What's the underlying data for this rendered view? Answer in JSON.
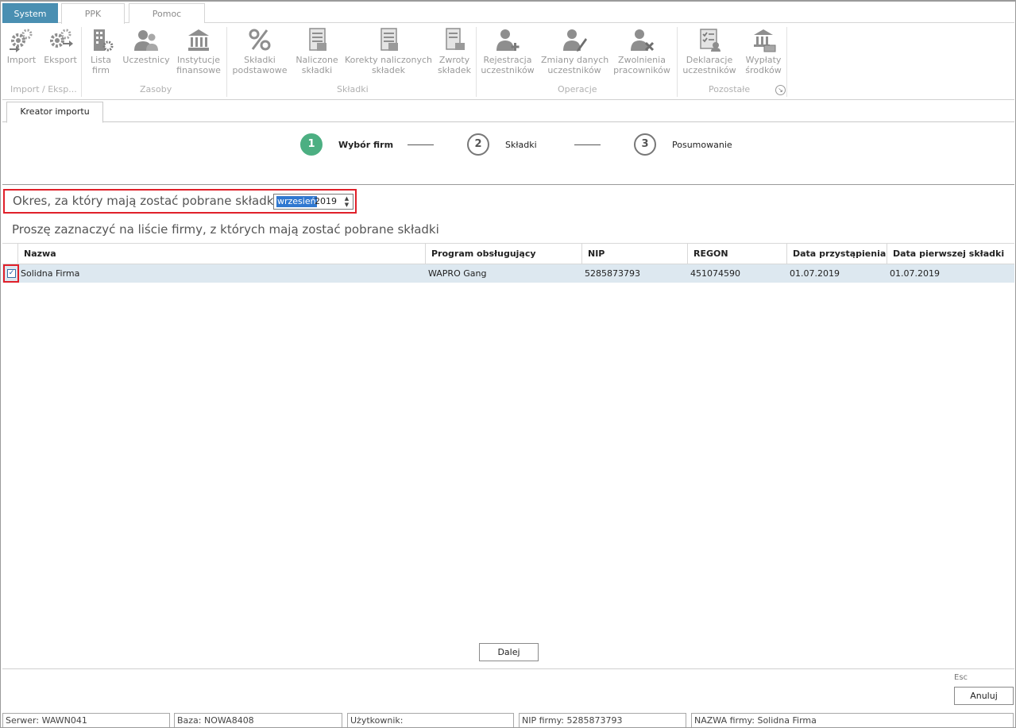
{
  "ribbon_tabs": {
    "system": "System",
    "ppk": "PPK",
    "pomoc": "Pomoc"
  },
  "ribbon": {
    "buttons": {
      "import": [
        "Import",
        ""
      ],
      "eksport": [
        "Eksport",
        ""
      ],
      "lista_firm": [
        "Lista",
        "firm"
      ],
      "uczestnicy": [
        "Uczestnicy",
        ""
      ],
      "instytucje": [
        "Instytucje",
        "finansowe"
      ],
      "skladki_podstawowe": [
        "Składki",
        "podstawowe"
      ],
      "naliczone": [
        "Naliczone",
        "składki"
      ],
      "korekty": [
        "Korekty naliczonych",
        "składek"
      ],
      "zwroty": [
        "Zwroty",
        "składek"
      ],
      "rejestracja": [
        "Rejestracja",
        "uczestników"
      ],
      "zmiany": [
        "Zmiany danych",
        "uczestników"
      ],
      "zwolnienia": [
        "Zwolnienia",
        "pracowników"
      ],
      "deklaracje": [
        "Deklaracje",
        "uczestników"
      ],
      "wyplaty": [
        "Wypłaty",
        "środków"
      ]
    },
    "groups": {
      "import_eksport": "Import / Eksp...",
      "zasoby": "Zasoby",
      "skladki": "Składki",
      "operacje": "Operacje",
      "pozostale": "Pozostałe"
    },
    "icons": {
      "import": "import-gears-icon",
      "eksport": "export-gears-icon",
      "lista_firm": "building-gear-icon",
      "uczestnicy": "users-icon",
      "instytucje": "bank-icon",
      "skladki_podstawowe": "percent-icon",
      "naliczone": "calculator-sheet-icon",
      "korekty": "correction-sheet-icon",
      "zwroty": "return-document-icon",
      "rejestracja": "user-add-icon",
      "zmiany": "user-edit-icon",
      "zwolnienia": "user-remove-icon",
      "deklaracje": "declaration-checklist-icon",
      "wyplaty": "payout-bank-icon"
    }
  },
  "doc_tab": {
    "label": "Kreator importu"
  },
  "wizard": {
    "steps": [
      {
        "number": "1",
        "label": "Wybór firm",
        "active": true
      },
      {
        "number": "2",
        "label": "Składki",
        "active": false
      },
      {
        "number": "3",
        "label": "Posumowanie",
        "active": false
      }
    ],
    "active_color": "#4caf82"
  },
  "period": {
    "label": "Okres, za który mają zostać pobrane składki",
    "month": "wrzesień",
    "year": "2019"
  },
  "instruction": "Proszę zaznaczyć na liście firmy, z których mają zostać pobrane składki",
  "grid": {
    "columns": [
      "Nazwa",
      "Program obsługujący",
      "NIP",
      "REGON",
      "Data przystąpienia",
      "Data pierwszej składki"
    ],
    "rows": [
      {
        "checked": true,
        "nazwa": "Solidna Firma",
        "program": "WAPRO Gang",
        "nip": "5285873793",
        "regon": "451074590",
        "data_przystapienia": "01.07.2019",
        "data_pierwszej_skladki": "01.07.2019"
      }
    ]
  },
  "buttons": {
    "next": "Dalej",
    "cancel": "Anuluj",
    "esc_hint": "Esc"
  },
  "statusbar": {
    "server": "Serwer: WAWN041",
    "db": "Baza: NOWA8408",
    "user": "Użytkownik:",
    "nip": "NIP firmy: 5285873793",
    "company": "NAZWA firmy: Solidna Firma"
  },
  "colors": {
    "system_tab": "#4a8fb2",
    "highlight_border": "#e0202a",
    "selected_row": "#dde8f0",
    "selection": "#3078d0"
  }
}
